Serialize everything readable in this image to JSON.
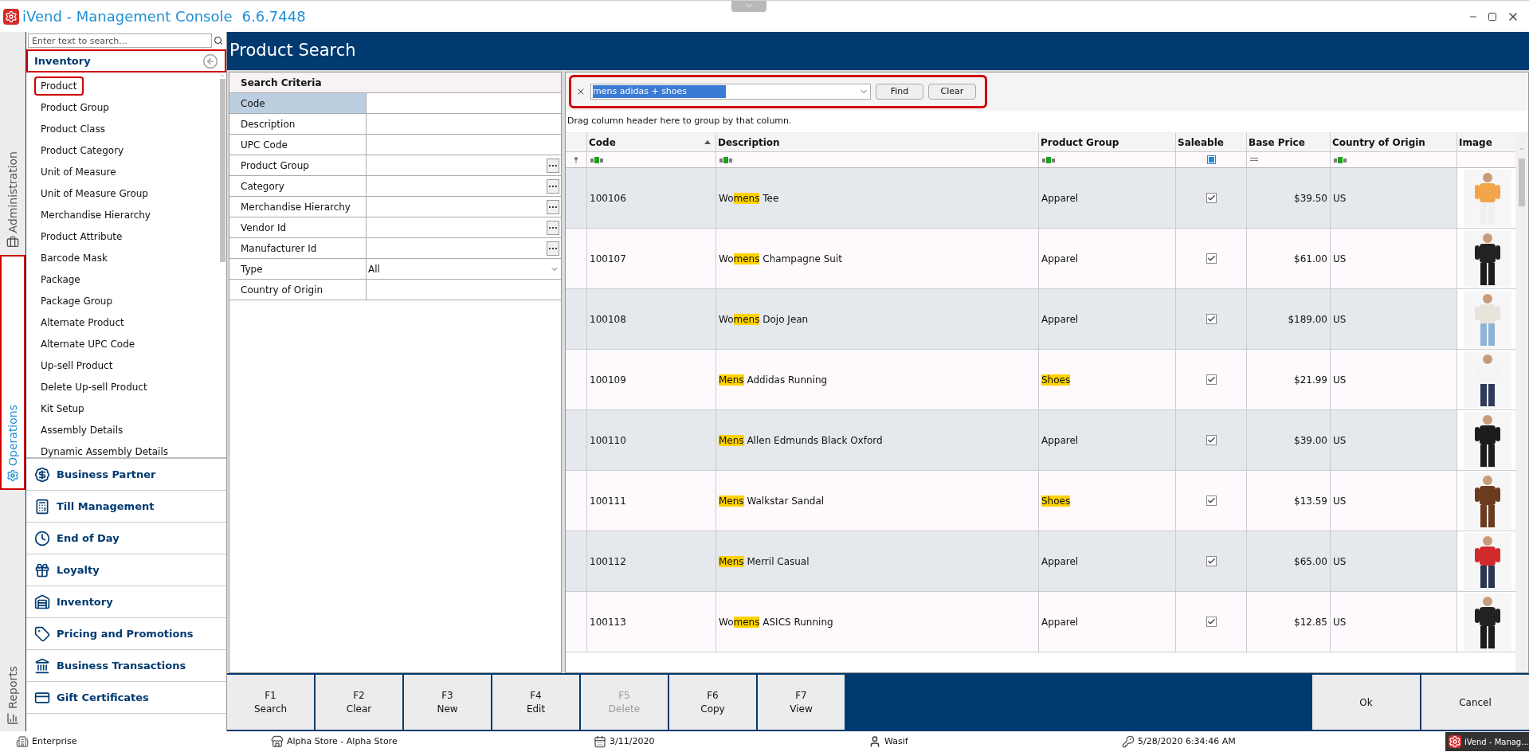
{
  "window": {
    "title": "iVend - Management Console",
    "version": "6.6.7448"
  },
  "vertical_tabs": [
    {
      "label": "Administration",
      "selected": false
    },
    {
      "label": "Operations",
      "selected": true
    },
    {
      "label": "Reports",
      "selected": false
    }
  ],
  "sidebar": {
    "search": {
      "placeholder": "Enter text to search..."
    },
    "section": "Inventory",
    "items": [
      {
        "label": "Product",
        "selected": true
      },
      {
        "label": "Product Group",
        "selected": false
      },
      {
        "label": "Product Class",
        "selected": false
      },
      {
        "label": "Product Category",
        "selected": false
      },
      {
        "label": "Unit of Measure",
        "selected": false
      },
      {
        "label": "Unit of Measure Group",
        "selected": false
      },
      {
        "label": "Merchandise Hierarchy",
        "selected": false
      },
      {
        "label": "Product Attribute",
        "selected": false
      },
      {
        "label": "Barcode Mask",
        "selected": false
      },
      {
        "label": "Package",
        "selected": false
      },
      {
        "label": "Package Group",
        "selected": false
      },
      {
        "label": "Alternate Product",
        "selected": false
      },
      {
        "label": "Alternate UPC Code",
        "selected": false
      },
      {
        "label": "Up-sell Product",
        "selected": false
      },
      {
        "label": "Delete Up-sell Product",
        "selected": false
      },
      {
        "label": "Kit Setup",
        "selected": false
      },
      {
        "label": "Assembly Details",
        "selected": false
      },
      {
        "label": "Dynamic Assembly Details",
        "selected": false
      }
    ],
    "categories": [
      "Business Partner",
      "Till Management",
      "End of Day",
      "Loyalty",
      "Inventory",
      "Pricing and Promotions",
      "Business Transactions",
      "Gift Certificates"
    ]
  },
  "page_title": "Product Search",
  "search_criteria": {
    "title": "Search Criteria",
    "fields": [
      {
        "label": "Code",
        "kind": "text",
        "selected": true
      },
      {
        "label": "Description",
        "kind": "text",
        "selected": false
      },
      {
        "label": "UPC Code",
        "kind": "text",
        "selected": false
      },
      {
        "label": "Product Group",
        "kind": "lookup",
        "selected": false
      },
      {
        "label": "Category",
        "kind": "lookup",
        "selected": false
      },
      {
        "label": "Merchandise Hierarchy",
        "kind": "lookup",
        "selected": false
      },
      {
        "label": "Vendor Id",
        "kind": "lookup",
        "selected": false
      },
      {
        "label": "Manufacturer Id",
        "kind": "lookup",
        "selected": false
      },
      {
        "label": "Type",
        "kind": "dropdown",
        "value": "All",
        "selected": false
      },
      {
        "label": "Country of Origin",
        "kind": "text",
        "selected": false
      }
    ]
  },
  "find_bar": {
    "value": "mens adidas + shoes",
    "buttons": [
      "Find",
      "Clear"
    ]
  },
  "group_hint": "Drag column header here to group by that column.",
  "table": {
    "columns": [
      "Code",
      "Description",
      "Product Group",
      "Saleable",
      "Base Price",
      "Country of Origin",
      "Image"
    ],
    "rows": [
      {
        "code": "100106",
        "description": [
          {
            "text": "Wo",
            "highlight": false
          },
          {
            "text": "mens",
            "highlight": true
          },
          {
            "text": " Tee",
            "highlight": false
          }
        ],
        "group": [
          {
            "text": "Apparel",
            "highlight": false
          }
        ],
        "saleable": true,
        "price": "$39.50",
        "country": "US"
      },
      {
        "code": "100107",
        "description": [
          {
            "text": "Wo",
            "highlight": false
          },
          {
            "text": "mens",
            "highlight": true
          },
          {
            "text": " Champagne Suit",
            "highlight": false
          }
        ],
        "group": [
          {
            "text": "Apparel",
            "highlight": false
          }
        ],
        "saleable": true,
        "price": "$61.00",
        "country": "US"
      },
      {
        "code": "100108",
        "description": [
          {
            "text": "Wo",
            "highlight": false
          },
          {
            "text": "mens",
            "highlight": true
          },
          {
            "text": " Dojo Jean",
            "highlight": false
          }
        ],
        "group": [
          {
            "text": "Apparel",
            "highlight": false
          }
        ],
        "saleable": true,
        "price": "$189.00",
        "country": "US"
      },
      {
        "code": "100109",
        "description": [
          {
            "text": "Mens",
            "highlight": true
          },
          {
            "text": " Addidas Running",
            "highlight": false
          }
        ],
        "group": [
          {
            "text": "Shoes",
            "highlight": true
          }
        ],
        "saleable": true,
        "price": "$21.99",
        "country": "US"
      },
      {
        "code": "100110",
        "description": [
          {
            "text": "Mens",
            "highlight": true
          },
          {
            "text": " Allen Edmunds Black Oxford",
            "highlight": false
          }
        ],
        "group": [
          {
            "text": "Apparel",
            "highlight": false
          }
        ],
        "saleable": true,
        "price": "$39.00",
        "country": "US"
      },
      {
        "code": "100111",
        "description": [
          {
            "text": "Mens",
            "highlight": true
          },
          {
            "text": " Walkstar Sandal",
            "highlight": false
          }
        ],
        "group": [
          {
            "text": "Shoes",
            "highlight": true
          }
        ],
        "saleable": true,
        "price": "$13.59",
        "country": "US"
      },
      {
        "code": "100112",
        "description": [
          {
            "text": "Mens",
            "highlight": true
          },
          {
            "text": " Merril Casual",
            "highlight": false
          }
        ],
        "group": [
          {
            "text": "Apparel",
            "highlight": false
          }
        ],
        "saleable": true,
        "price": "$65.00",
        "country": "US"
      },
      {
        "code": "100113",
        "description": [
          {
            "text": "Wo",
            "highlight": false
          },
          {
            "text": "mens",
            "highlight": true
          },
          {
            "text": " ASICS Running",
            "highlight": false
          }
        ],
        "group": [
          {
            "text": "Apparel",
            "highlight": false
          }
        ],
        "saleable": true,
        "price": "$12.85",
        "country": "US"
      }
    ]
  },
  "function_keys": [
    {
      "key": "F1",
      "label": "Search",
      "disabled": false
    },
    {
      "key": "F2",
      "label": "Clear",
      "disabled": false
    },
    {
      "key": "F3",
      "label": "New",
      "disabled": false
    },
    {
      "key": "F4",
      "label": "Edit",
      "disabled": false
    },
    {
      "key": "F5",
      "label": "Delete",
      "disabled": true
    },
    {
      "key": "F6",
      "label": "Copy",
      "disabled": false
    },
    {
      "key": "F7",
      "label": "View",
      "disabled": false
    }
  ],
  "dialog_buttons": [
    "Ok",
    "Cancel"
  ],
  "status_bar": {
    "company": "Enterprise",
    "store": "Alpha Store - Alpha Store",
    "business_date": "3/11/2020",
    "user": "Wasif",
    "login_time": "5/28/2020 6:34:46 AM",
    "taskbar_item": "iVend - Manag..."
  }
}
